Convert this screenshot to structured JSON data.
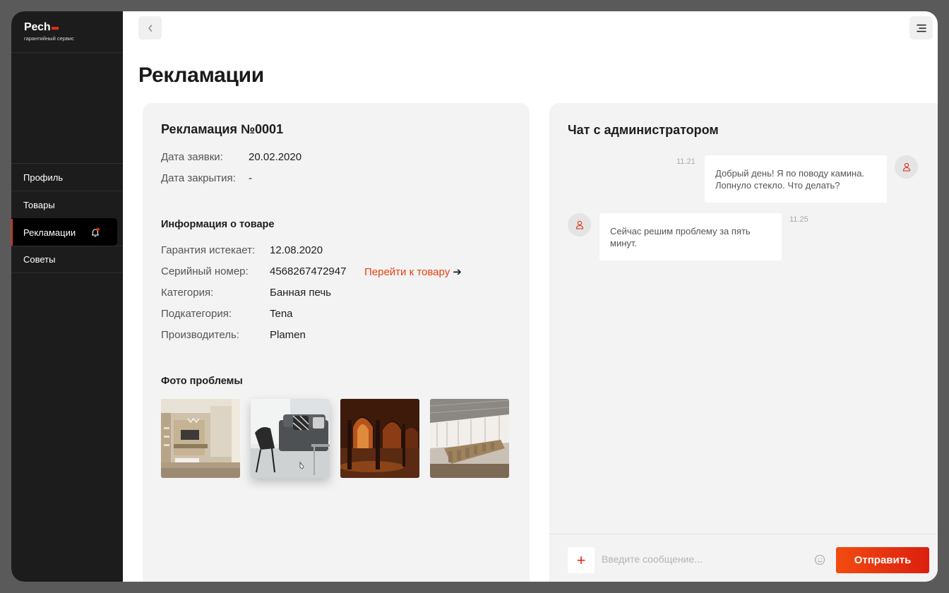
{
  "brand": {
    "name": "Pech",
    "tagline": "гарантийный сервис"
  },
  "sidebar": {
    "items": [
      {
        "label": "Профиль",
        "icon": ""
      },
      {
        "label": "Товары",
        "icon": ""
      },
      {
        "label": "Рекламации",
        "icon": "bell-icon",
        "active": true,
        "notification": true
      },
      {
        "label": "Советы",
        "icon": ""
      }
    ]
  },
  "header": {
    "back_icon": "chevron-left-icon",
    "menu_icon": "menu-icon"
  },
  "page": {
    "title": "Рекламации"
  },
  "claim": {
    "title": "Рекламация №0001",
    "date_label": "Дата заявки:",
    "date_value": "20.02.2020",
    "close_label": "Дата закрытия:",
    "close_value": "-"
  },
  "product": {
    "section_title": "Информация о товаре",
    "warranty_label": "Гарантия истекает:",
    "warranty_value": "12.08.2020",
    "serial_label": "Серийный номер:",
    "serial_value": "4568267472947",
    "goto_link": "Перейти к товару",
    "category_label": "Категория:",
    "category_value": "Банная печь",
    "subcategory_label": "Подкатегория:",
    "subcategory_value": "Tena",
    "manufacturer_label": "Производитель:",
    "manufacturer_value": "Plamen"
  },
  "photos": {
    "section_title": "Фото проблемы",
    "items": [
      "living-room-photo",
      "armchair-photo",
      "arched-hall-photo",
      "conference-room-photo"
    ]
  },
  "chat": {
    "title": "Чат с администратором",
    "messages": [
      {
        "time": "11.21",
        "text": "Добрый день! Я по поводу камина. Лопнуло стекло. Что делать?",
        "side": "right"
      },
      {
        "time": "11.25",
        "text": "Сейчас решим проблему за пять минут.",
        "side": "left"
      }
    ],
    "input_placeholder": "Введите сообщение...",
    "send_label": "Отправить",
    "plus_label": "+"
  },
  "colors": {
    "accent": "#e8400f",
    "sidebar": "#1c1c1c",
    "card": "#f3f3f3"
  }
}
